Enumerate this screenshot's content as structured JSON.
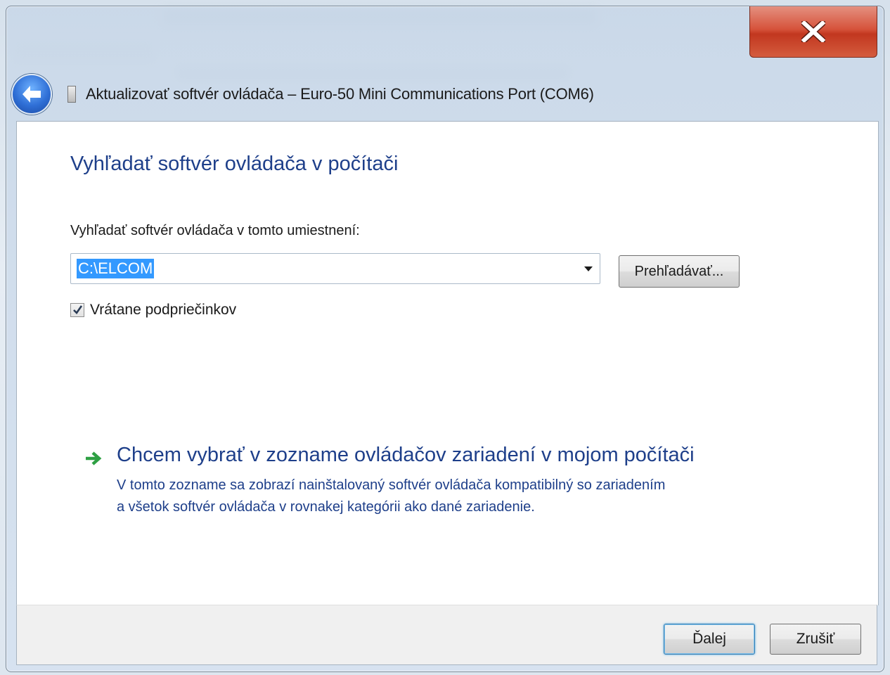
{
  "window": {
    "title": "Aktualizovať softvér ovládača – Euro-50 Mini Communications Port (COM6)",
    "close_icon": "close-x-icon",
    "back_icon": "back-arrow-icon",
    "device_icon": "device-icon"
  },
  "content": {
    "heading": "Vyhľadať softvér ovládača v počítači",
    "location_label": "Vyhľadať softvér ovládača v tomto umiestnení:",
    "location_value": "C:\\ELCOM",
    "browse_label": "Prehľadávať...",
    "include_subfolders_label": "Vrátane podpriečinkov",
    "include_subfolders_checked": true,
    "pick_link": {
      "icon": "green-arrow-icon",
      "title": "Chcem vybrať v zozname ovládačov zariadení v mojom počítači",
      "desc_line1": "V tomto zozname sa zobrazí nainštalovaný softvér ovládača kompatibilný so zariadením",
      "desc_line2": "a všetok softvér ovládača v rovnakej kategórii ako dané zariadenie."
    }
  },
  "footer": {
    "next_label": "Ďalej",
    "cancel_label": "Zrušiť"
  },
  "colors": {
    "heading": "#1e3f8a",
    "selection": "#3399ff",
    "close_red": "#c2371f"
  }
}
